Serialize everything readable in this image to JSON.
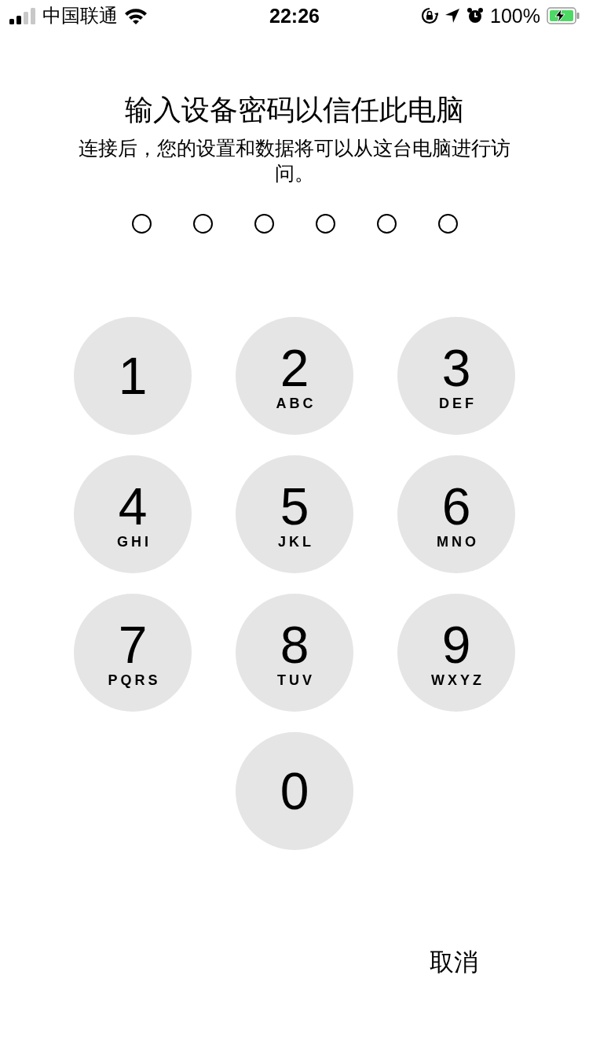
{
  "status_bar": {
    "carrier": "中国联通",
    "time": "22:26",
    "battery_text": "100%",
    "charging": true
  },
  "title": "输入设备密码以信任此电脑",
  "message": "连接后，您的设置和数据将可以从这台电脑进行访问。",
  "passcode_dots": [
    {
      "filled": false
    },
    {
      "filled": false
    },
    {
      "filled": false
    },
    {
      "filled": false
    },
    {
      "filled": false
    },
    {
      "filled": false
    }
  ],
  "keypad": [
    {
      "digit": "1"
    },
    {
      "digit": "2",
      "letters": "ABC"
    },
    {
      "digit": "3",
      "letters": "DEF"
    },
    {
      "digit": "4",
      "letters": "GHI"
    },
    {
      "digit": "5",
      "letters": "JKL"
    },
    {
      "digit": "6",
      "letters": "MNO"
    },
    {
      "digit": "7",
      "letters": "PQRS"
    },
    {
      "digit": "8",
      "letters": "TUV"
    },
    {
      "digit": "9",
      "letters": "WXYZ"
    },
    {
      "digit": "0"
    }
  ],
  "cancel_button": "取消"
}
